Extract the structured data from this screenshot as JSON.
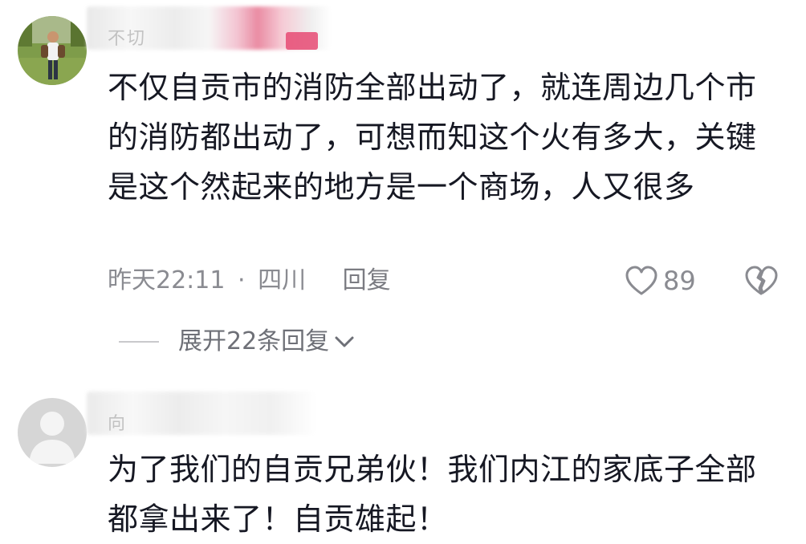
{
  "comments": [
    {
      "username": "不切",
      "text": "不仅自贡市的消防全部出动了，就连周边几个市的消防都出动了，可想而知这个火有多大，关键是这个然起来的地方是一个商场，人又很多",
      "time": "昨天22:11",
      "separator": "·",
      "location": "四川",
      "reply_label": "回复",
      "likes": "89",
      "expand_label": "展开22条回复"
    },
    {
      "username": "向",
      "text": "为了我们的自贡兄弟伙！我们内江的家底子全部都拿出来了！自贡雄起！"
    }
  ],
  "colors": {
    "text": "#161823",
    "meta": "#8a8b91",
    "author_badge": "#e64a73"
  },
  "icons": [
    "heart-outline-icon",
    "broken-heart-icon",
    "chevron-down-icon",
    "default-avatar-icon"
  ]
}
